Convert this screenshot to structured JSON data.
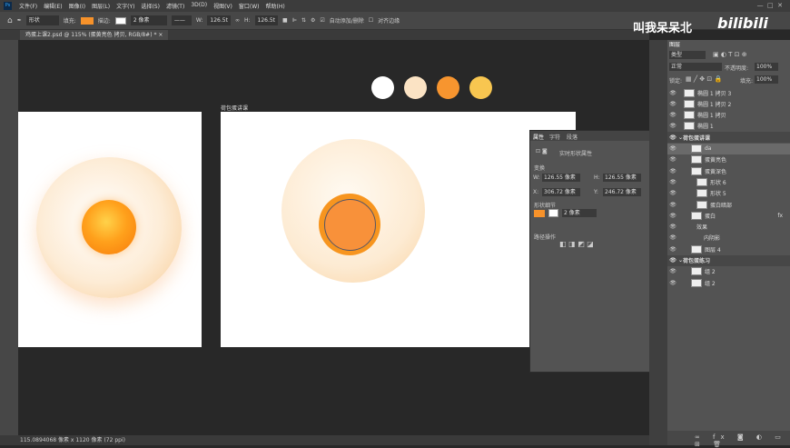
{
  "menu": [
    "文件(F)",
    "编辑(E)",
    "图像(I)",
    "图层(L)",
    "文字(Y)",
    "选择(S)",
    "滤镜(T)",
    "3D(D)",
    "视图(V)",
    "窗口(W)",
    "帮助(H)"
  ],
  "options": {
    "mode": "形状",
    "fill_label": "填充:",
    "fill_color": "#f7922a",
    "stroke_label": "描边:",
    "stroke_width": "2 像素",
    "w_label": "W:",
    "w": "126.5t",
    "h_label": "H:",
    "h": "126.5t",
    "auto_add": "自动添加/删除",
    "align_edges": "对齐边缘"
  },
  "document_tab": "鸡蛋上课2.psd @ 115% (蛋黄亮色 拷贝, RGB/8#) *",
  "watermark": "叫我呆呆北",
  "logo": "bilibili",
  "artboard_label": "荷包蛋讲课",
  "swatches": [
    "#ffffff",
    "#fbe3c4",
    "#f7952f",
    "#f8c650"
  ],
  "status": "115.0894068 像素 x 1120 像素 (72 ppi)",
  "properties": {
    "tabs": [
      "属性",
      "字符",
      "段落"
    ],
    "subtitle": "实时形状属性",
    "transform": "变换",
    "w_label": "W:",
    "w": "126.55 像素",
    "h_label": "H:",
    "h": "126.55 像素",
    "x_label": "X:",
    "x": "306.72 像素",
    "y_label": "Y:",
    "y": "246.72 像素",
    "shape_details": "形状细节",
    "stroke_width": "2 像素",
    "path_ops": "路径操作"
  },
  "layers": {
    "tab": "图层",
    "filter": "类型",
    "blend": "正常",
    "opacity_label": "不透明度:",
    "opacity": "100%",
    "lock_label": "锁定:",
    "fill_label": "填充:",
    "fill": "100%",
    "items": [
      {
        "name": "椭圆 1 拷贝 3",
        "group": false
      },
      {
        "name": "椭圆 1 拷贝 2",
        "group": false
      },
      {
        "name": "椭圆 1 拷贝",
        "group": false
      },
      {
        "name": "椭圆 1",
        "group": false
      },
      {
        "name": "荷包蛋讲课",
        "group": true
      },
      {
        "name": "da",
        "group": false
      },
      {
        "name": "蛋黄亮色",
        "group": false
      },
      {
        "name": "蛋黄深色",
        "group": false
      },
      {
        "name": "形状 6",
        "group": false
      },
      {
        "name": "形状 5",
        "group": false
      },
      {
        "name": "蛋白暗部",
        "group": false
      },
      {
        "name": "蛋白",
        "group": false
      },
      {
        "name": "效果",
        "group": false
      },
      {
        "name": "内阴影",
        "group": false
      },
      {
        "name": "图层 4",
        "group": false
      },
      {
        "name": "荷包蛋练习",
        "group": true
      },
      {
        "name": "组 2",
        "group": false
      },
      {
        "name": "组 2",
        "group": false
      }
    ]
  }
}
